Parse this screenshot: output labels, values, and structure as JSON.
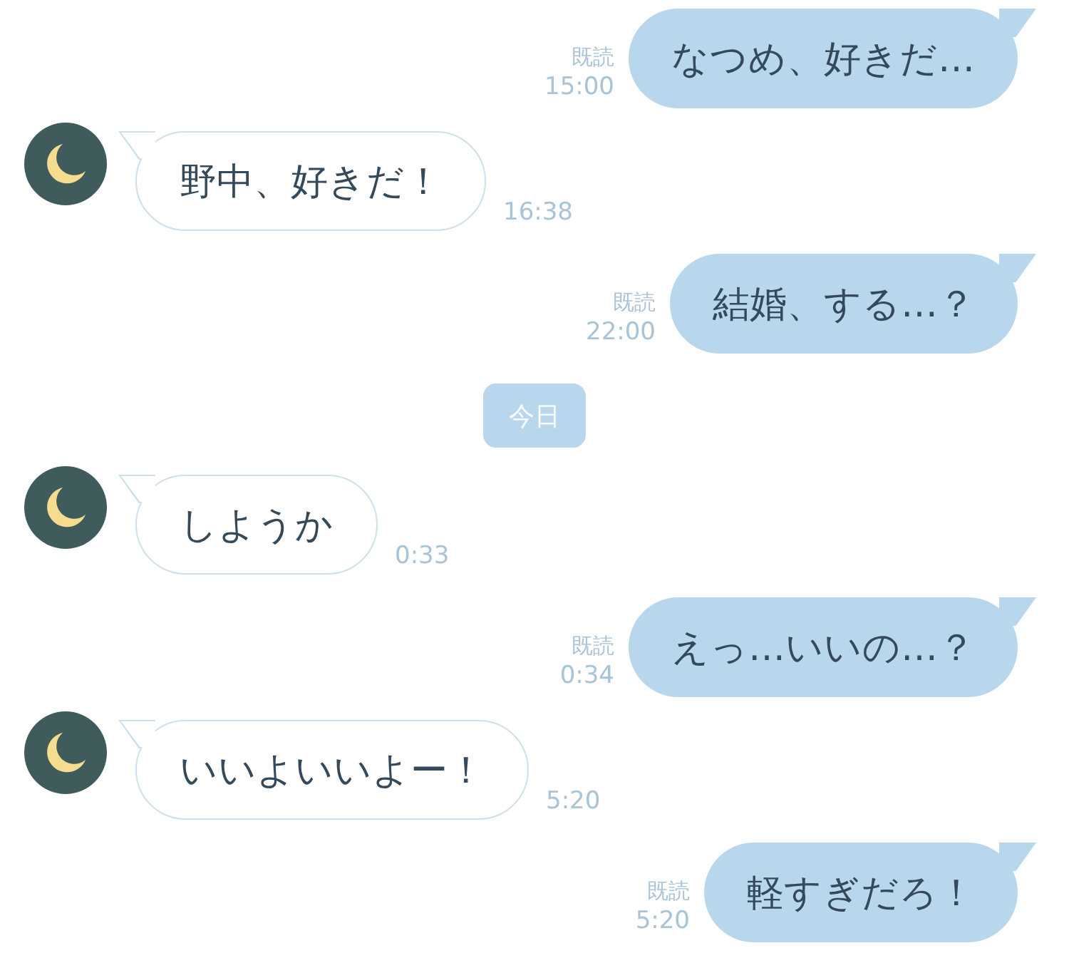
{
  "messages": [
    {
      "kind": "sent",
      "read": "既読",
      "time": "15:00",
      "text": "なつめ、好きだ…"
    },
    {
      "kind": "received",
      "time": "16:38",
      "text": "野中、好きだ！"
    },
    {
      "kind": "sent",
      "read": "既読",
      "time": "22:00",
      "text": "結婚、する…？"
    },
    {
      "kind": "date",
      "text": "今日"
    },
    {
      "kind": "received",
      "time": "0:33",
      "text": "しようか"
    },
    {
      "kind": "sent",
      "read": "既読",
      "time": "0:34",
      "text": "えっ…いいの…？"
    },
    {
      "kind": "received",
      "time": "5:20",
      "text": "いいよいいよー！"
    },
    {
      "kind": "sent",
      "read": "既読",
      "time": "5:20",
      "text": "軽すぎだろ！"
    }
  ]
}
